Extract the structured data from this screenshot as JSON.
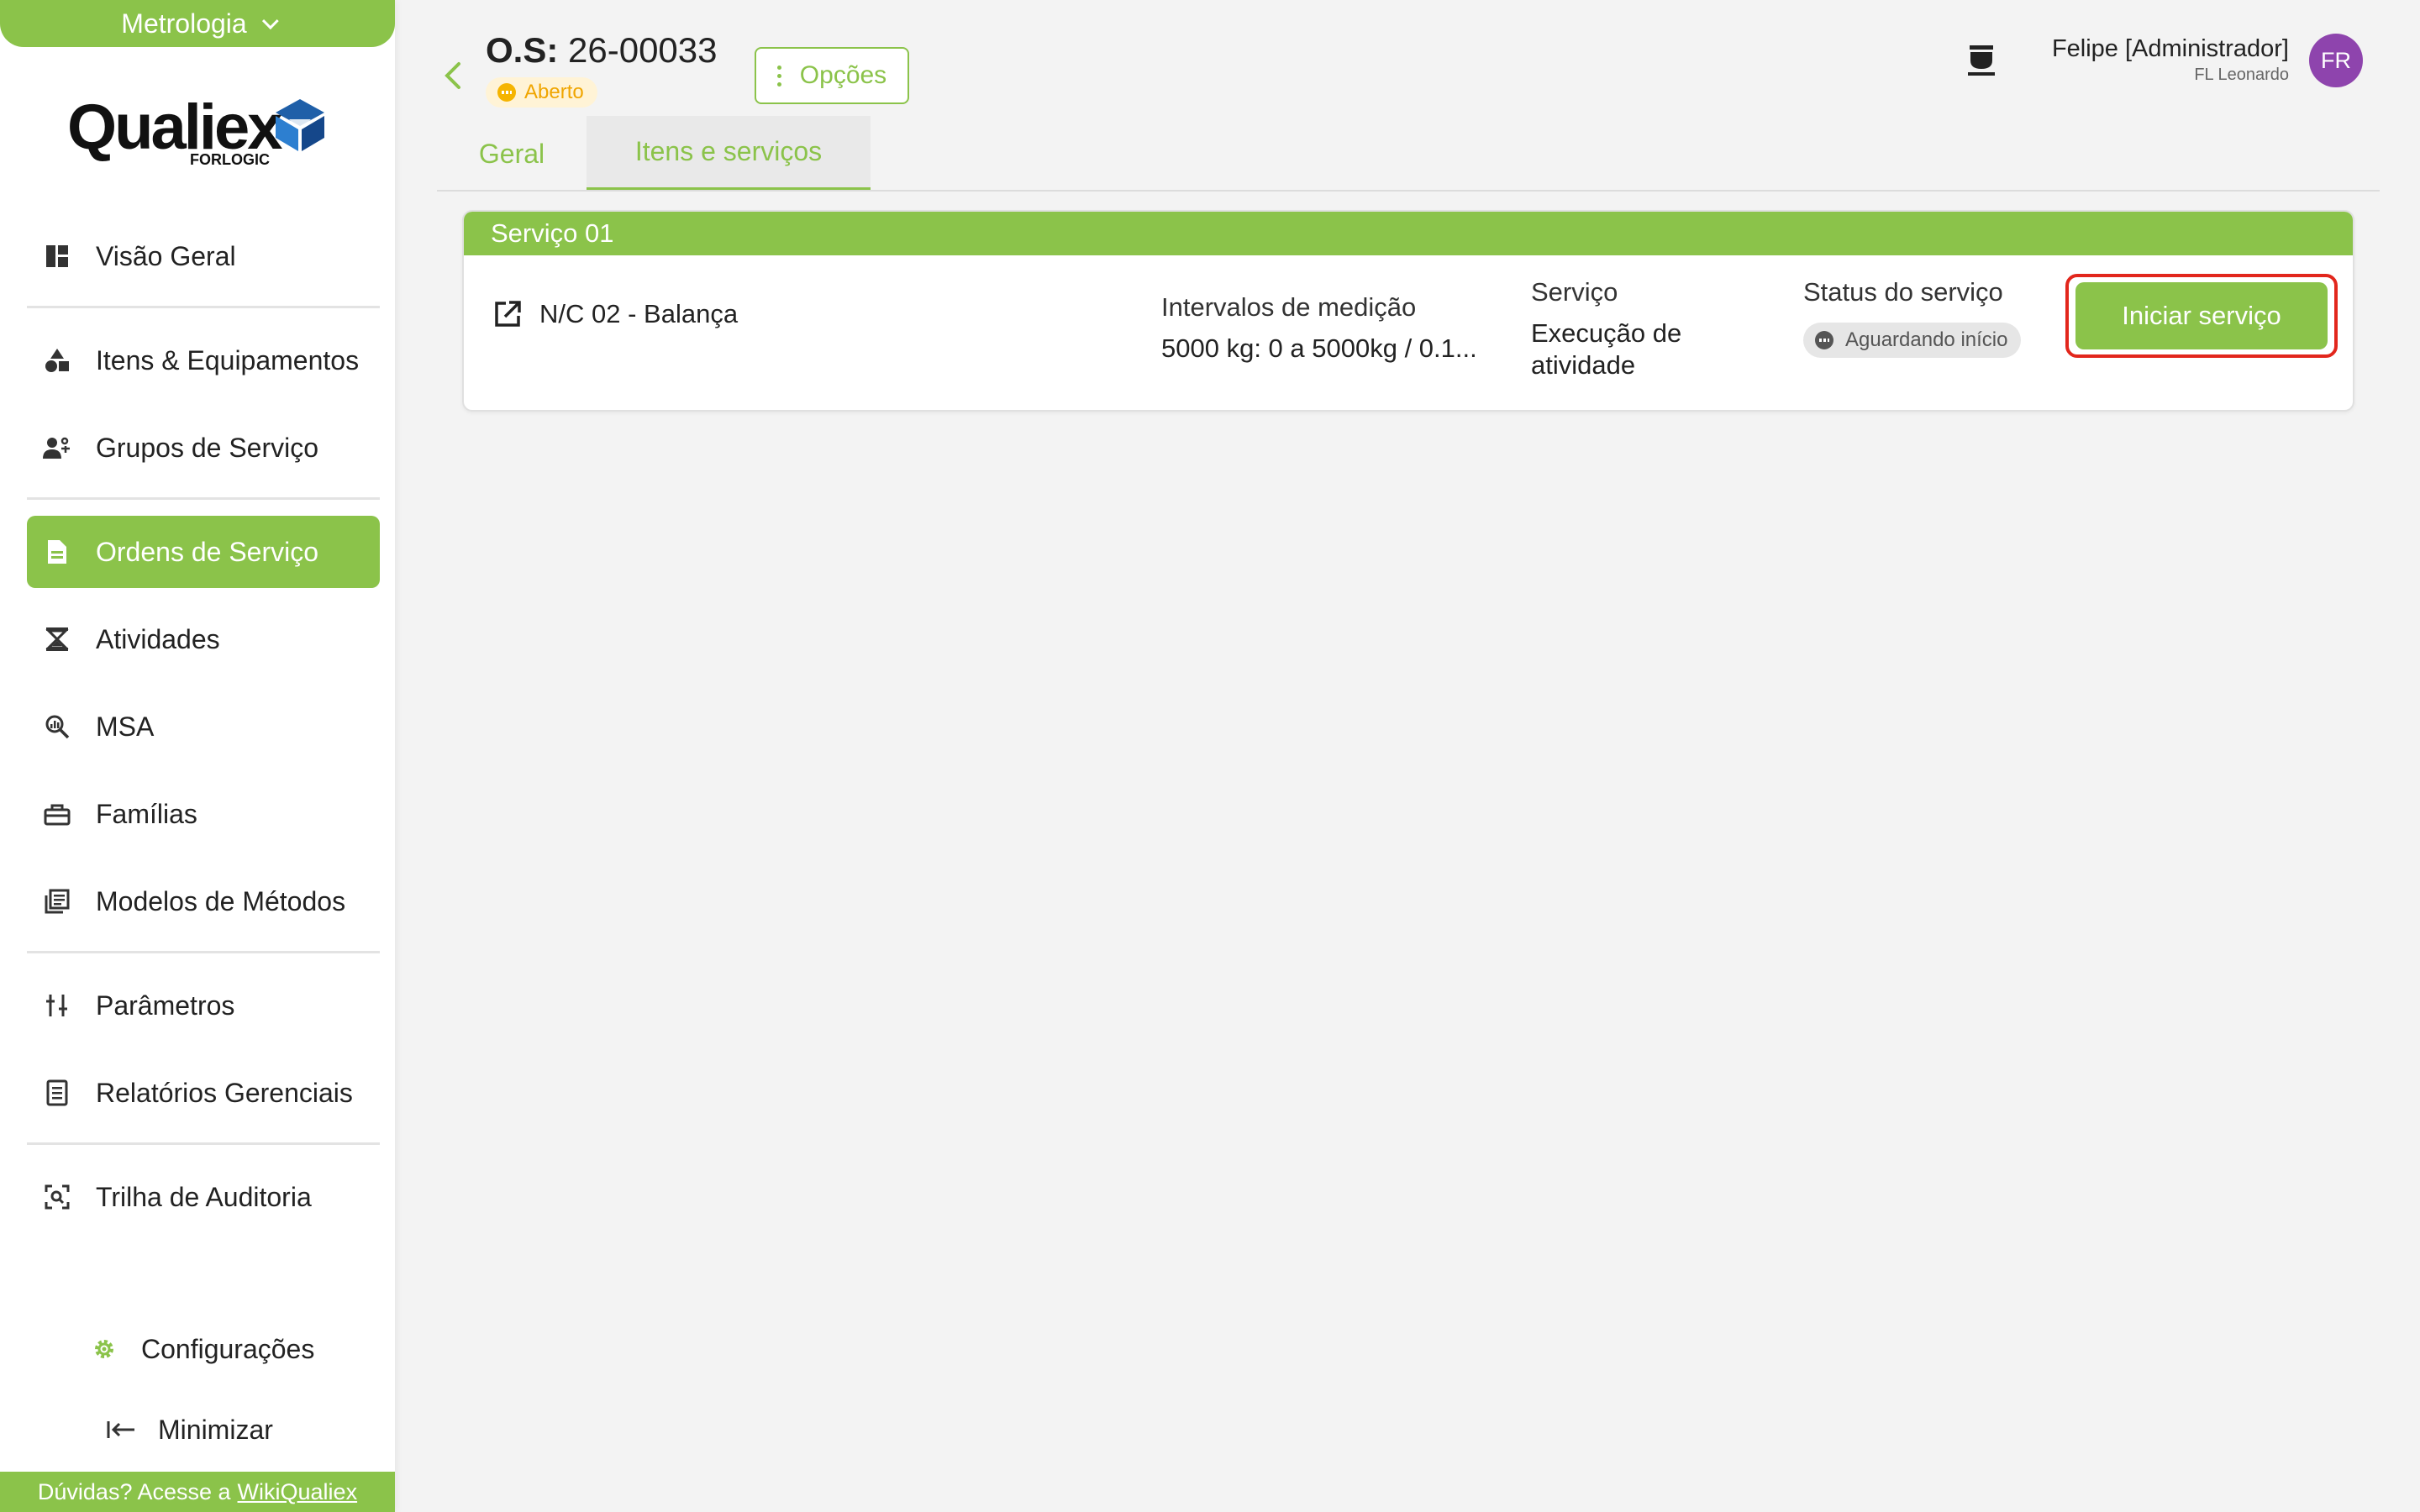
{
  "sidebar": {
    "module": "Metrologia",
    "logo": {
      "brand": "Qualiex",
      "sub": "FORLOGIC"
    },
    "items": [
      {
        "label": "Visão Geral",
        "icon": "dashboard-icon"
      },
      {
        "label": "Itens & Equipamentos",
        "icon": "shapes-icon"
      },
      {
        "label": "Grupos de Serviço",
        "icon": "group-icon"
      },
      {
        "label": "Ordens de Serviço",
        "icon": "document-icon",
        "active": true
      },
      {
        "label": "Atividades",
        "icon": "hourglass-icon"
      },
      {
        "label": "MSA",
        "icon": "magnifier-icon"
      },
      {
        "label": "Famílias",
        "icon": "toolbox-icon"
      },
      {
        "label": "Modelos de Métodos",
        "icon": "library-icon"
      },
      {
        "label": "Parâmetros",
        "icon": "sliders-icon"
      },
      {
        "label": "Relatórios Gerenciais",
        "icon": "report-icon"
      },
      {
        "label": "Trilha de Auditoria",
        "icon": "audit-icon"
      }
    ],
    "settings_label": "Configurações",
    "minimize_label": "Minimizar",
    "help_text": "Dúvidas? Acesse a",
    "help_link": "WikiQualiex"
  },
  "header": {
    "os_prefix": "O.S:",
    "os_number": "26-00033",
    "status": "Aberto",
    "options_label": "Opções",
    "user_name": "Felipe [Administrador]",
    "user_org": "FL Leonardo",
    "avatar_initials": "FR"
  },
  "tabs": [
    {
      "label": "Geral"
    },
    {
      "label": "Itens e serviços",
      "active": true
    }
  ],
  "service": {
    "title": "Serviço 01",
    "item_name": "N/C 02 - Balança",
    "intervals_label": "Intervalos de medição",
    "intervals_value": "5000 kg: 0 a 5000kg / 0.1...",
    "service_label": "Serviço",
    "service_value": "Execução de atividade",
    "status_label": "Status do serviço",
    "status_value": "Aguardando início",
    "start_button": "Iniciar serviço"
  },
  "colors": {
    "accent": "#8bc34a",
    "status_open": "#f5b400",
    "avatar": "#8e44ad",
    "highlight": "#e2261c"
  }
}
